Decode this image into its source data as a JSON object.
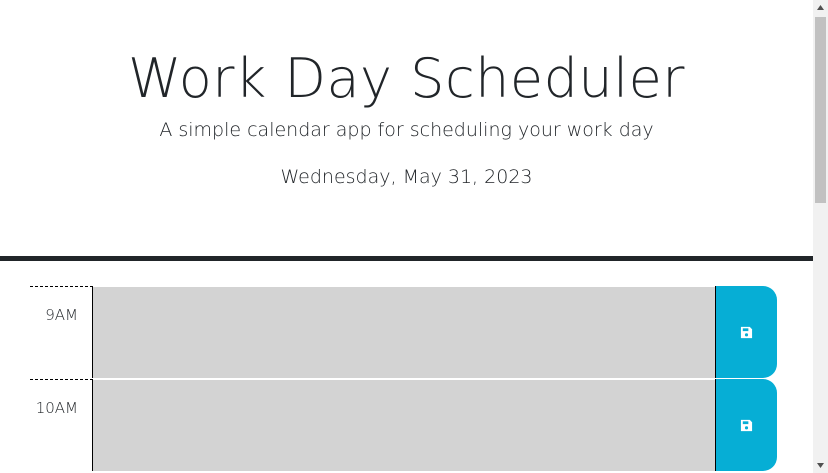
{
  "header": {
    "title": "Work Day Scheduler",
    "subtitle": "A simple calendar app for scheduling your work day",
    "current_date": "Wednesday, May 31, 2023"
  },
  "time_blocks": [
    {
      "hour": "9AM",
      "description": "",
      "save_icon": "save-icon"
    },
    {
      "hour": "10AM",
      "description": "",
      "save_icon": "save-icon"
    }
  ],
  "colors": {
    "past_block": "#d3d3d3",
    "save_button": "#06aed5",
    "header_border": "#212529"
  },
  "scrollbar": {
    "up_icon": "triangle-up-icon",
    "down_icon": "triangle-down-icon"
  }
}
